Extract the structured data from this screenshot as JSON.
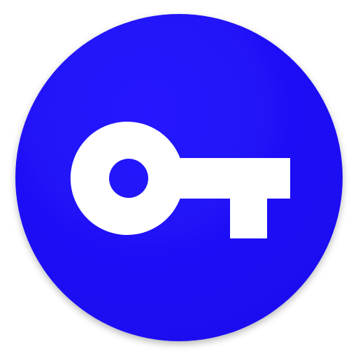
{
  "icon": {
    "name": "key-icon",
    "background_color": "#1a0ff0",
    "background_color_light": "#2614ff",
    "glyph_color": "#ffffff"
  }
}
